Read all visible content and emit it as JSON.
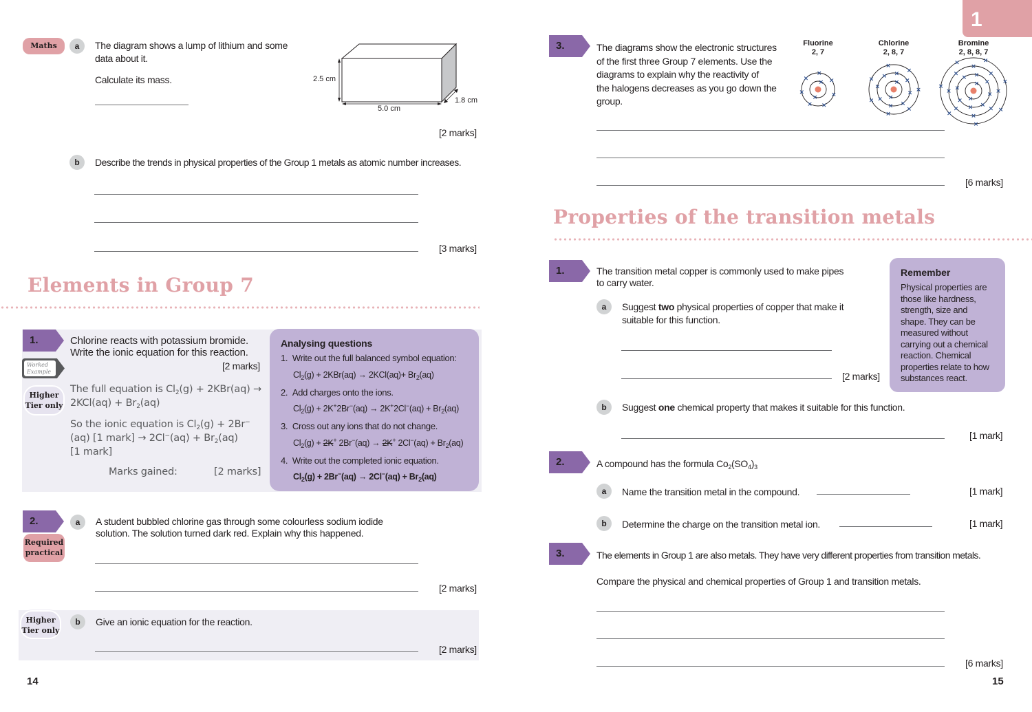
{
  "chapter_tab": "1",
  "left_page": {
    "page_number": "14",
    "maths_question": {
      "badge": "Maths",
      "part_a": {
        "letter": "a",
        "text_line1": "The diagram shows a lump of lithium and some",
        "text_line2": "data about it.",
        "instruction": "Calculate its mass.",
        "marks": "[2 marks]",
        "diagram": {
          "height_label": "2.5 cm",
          "length_label": "5.0 cm",
          "depth_label": "1.8 cm"
        }
      },
      "part_b": {
        "letter": "b",
        "text": "Describe the trends in physical properties of the Group 1 metals as atomic number increases.",
        "marks": "[3 marks]"
      }
    },
    "section_title": "Elements in Group 7",
    "q1": {
      "number": "1.",
      "worked_example_line1": "Worked",
      "worked_example_line2": "Example",
      "tier_line1": "Higher",
      "tier_line2": "Tier only",
      "question_line1": "Chlorine reacts with potassium bromide.",
      "question_line2": "Write the ionic equation for this reaction.",
      "marks": "[2 marks]",
      "answer_p1_line1_a": "The full equation is Cl",
      "answer_p1_line1_sub": "2",
      "answer_p1_line1_b": "(g) + 2KBr(aq) →",
      "answer_p1_line2_a": "2KCl(aq) + Br",
      "answer_p1_line2_sub": "2",
      "answer_p1_line2_b": "(aq)",
      "answer_p2_line1_a": "So the ionic equation is Cl",
      "answer_p2_line1_sub": "2",
      "answer_p2_line1_b": "(g) + 2Br",
      "answer_p2_line1_sup": "−",
      "answer_p2_line2_a": "(aq) [1 mark] → 2Cl",
      "answer_p2_line2_sup": "−",
      "answer_p2_line2_b": "(aq) + Br",
      "answer_p2_line2_sub": "2",
      "answer_p2_line2_c": "(aq)",
      "answer_p2_line3": "[1 mark]",
      "marks_gained_label": "Marks gained:",
      "marks_gained_value": "[2 marks]",
      "analysing": {
        "title": "Analysing questions",
        "steps": [
          {
            "num": "1.",
            "text": "Write out the full balanced symbol equation:"
          },
          {
            "num": "2.",
            "text": "Add charges onto the ions."
          },
          {
            "num": "3.",
            "text": "Cross out any ions that do not change."
          },
          {
            "num": "4.",
            "text": "Write out the completed ionic equation."
          }
        ],
        "eq1": {
          "a": "Cl",
          "s1": "2",
          "b": "(g) + 2KBr(aq) → 2KCl(aq)+ Br",
          "s2": "2",
          "c": "(aq)"
        },
        "eq2": {
          "a": "Cl",
          "s1": "2",
          "b": "(g) + 2K",
          "p1": "+",
          "c": "2Br",
          "p2": "−",
          "d": "(aq) → 2K",
          "p3": "+",
          "e": "2Cl",
          "p4": "−",
          "f": "(aq) + Br",
          "s2": "2",
          "g": "(aq)"
        },
        "eq3": {
          "a": "Cl",
          "s1": "2",
          "b": "(g) + ",
          "x1": "2K",
          "p1": "+",
          "c": " 2Br",
          "p2": "−",
          "d": "(aq) → ",
          "x2": "2K",
          "p3": "+",
          "e": " 2Cl",
          "p4": "−",
          "f": "(aq) + Br",
          "s2": "2",
          "g": "(aq)"
        },
        "eq4": {
          "a": "Cl",
          "s1": "2",
          "b": "(g) + 2Br",
          "p1": "−",
          "c": "(aq) → 2Cl",
          "p2": "−",
          "d": "(aq) + Br",
          "s2": "2",
          "e": "(aq)"
        }
      }
    },
    "q2": {
      "number": "2.",
      "badge_line1": "Required",
      "badge_line2": "practical",
      "part_a": {
        "letter": "a",
        "text_line1": "A student bubbled chlorine gas through some colourless sodium iodide",
        "text_line2": "solution. The solution turned dark red. Explain why this happened.",
        "marks": "[2 marks]"
      },
      "part_b": {
        "letter": "b",
        "tier_line1": "Higher",
        "tier_line2": "Tier only",
        "text": "Give an ionic equation for the reaction.",
        "marks": "[2 marks]"
      }
    }
  },
  "right_page": {
    "page_number": "15",
    "q3_group7": {
      "number": "3.",
      "text_lines": [
        "The diagrams show the electronic structures",
        "of the first three Group 7 elements. Use the",
        "diagrams to explain why the reactivity of",
        "the halogens decreases as you go down the",
        "group."
      ],
      "marks": "[6 marks]",
      "atoms": [
        {
          "name": "Fluorine",
          "config": "2, 7",
          "shells": [
            2,
            7
          ]
        },
        {
          "name": "Chlorine",
          "config": "2, 8, 7",
          "shells": [
            2,
            8,
            7
          ]
        },
        {
          "name": "Bromine",
          "config": "2, 8, 8, 7",
          "shells": [
            2,
            8,
            8,
            7
          ]
        }
      ]
    },
    "section_title": "Properties of the transition metals",
    "q1": {
      "number": "1.",
      "text_line1": "The transition metal copper is commonly used to make pipes",
      "text_line2": "to carry water.",
      "part_a": {
        "letter": "a",
        "pre": "Suggest ",
        "bold": "two",
        "post": " physical properties of copper that make it",
        "line2": "suitable for this function.",
        "marks": "[2 marks]"
      },
      "part_b": {
        "letter": "b",
        "pre": "Suggest ",
        "bold": "one",
        "post": " chemical property that makes it suitable for this function.",
        "marks": "[1 mark]"
      },
      "remember": {
        "title": "Remember",
        "lines": [
          "Physical properties are",
          "those like hardness,",
          "strength, size and",
          "shape. They can be",
          "measured without",
          "carrying out a chemical",
          "reaction. Chemical",
          "properties relate to how",
          "substances react."
        ]
      }
    },
    "q2": {
      "number": "2.",
      "text_a": "A compound has the formula Co",
      "sub1": "2",
      "text_b": "(SO",
      "sub2": "4",
      "text_c": ")",
      "sub3": "3",
      "part_a": {
        "letter": "a",
        "text": "Name the transition metal in the compound.",
        "marks": "[1 mark]"
      },
      "part_b": {
        "letter": "b",
        "text": "Determine the charge on the transition metal ion.",
        "marks": "[1 mark]"
      }
    },
    "q3": {
      "number": "3.",
      "text_line1": "The elements in Group 1 are also metals. They have very different properties from transition metals.",
      "text_line2": "Compare the physical and chemical properties of Group 1 and transition metals.",
      "marks": "[6 marks]"
    }
  },
  "colors": {
    "accent_pink": "#e0a1a6",
    "accent_purple": "#8a68a8",
    "panel_purple": "#c0b2d6",
    "electron_blue": "#2b4d8c",
    "nucleus": "#e8806a"
  }
}
